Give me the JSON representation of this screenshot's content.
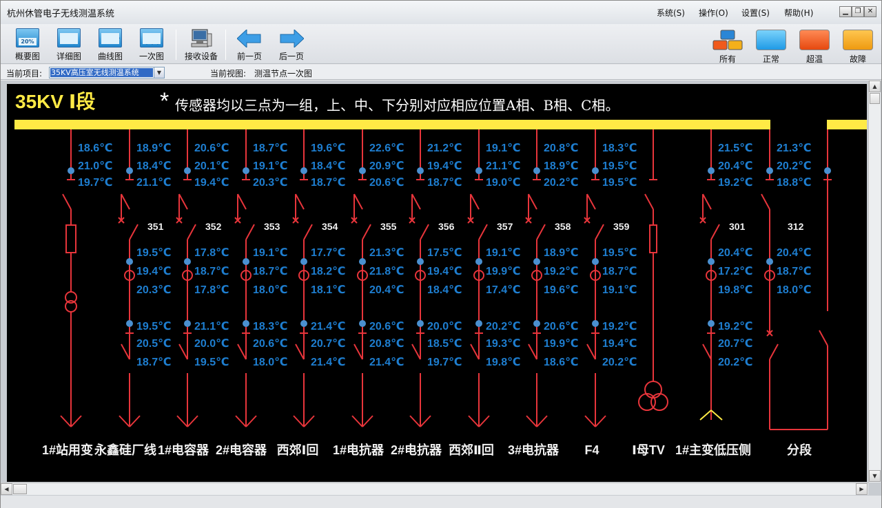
{
  "app": {
    "title": "杭州休管电子无线测温系统"
  },
  "menu": [
    {
      "label": "系统(S)"
    },
    {
      "label": "操作(O)"
    },
    {
      "label": "设置(S)"
    },
    {
      "label": "帮助(H)"
    }
  ],
  "window_buttons": [
    "minimize",
    "restore",
    "close"
  ],
  "toolbar": {
    "buttons": [
      {
        "label": "概要图",
        "icon": "overview-icon"
      },
      {
        "label": "详细图",
        "icon": "detail-icon"
      },
      {
        "label": "曲线图",
        "icon": "curve-icon"
      },
      {
        "label": "一次图",
        "icon": "primary-diagram-icon"
      },
      {
        "label": "接收设备",
        "icon": "receiver-device-icon"
      },
      {
        "label": "前一页",
        "icon": "prev-page-arrow-icon"
      },
      {
        "label": "后一页",
        "icon": "next-page-arrow-icon"
      }
    ],
    "overview_icon_text": "20%",
    "legend": [
      {
        "label": "所有",
        "color": "#2a86d6"
      },
      {
        "label": "正常",
        "color": "#2aa6f0"
      },
      {
        "label": "超温",
        "color": "#f05a1c"
      },
      {
        "label": "故障",
        "color": "#f4a21a"
      }
    ]
  },
  "infobar": {
    "project_label": "当前项目:",
    "project_value": "35KV高压室无线测温系统",
    "view_label": "当前视图:",
    "view_value": "测温节点一次图"
  },
  "diagram": {
    "section_title": "35KV Ⅰ段",
    "note_star": "*",
    "note": "传感器均以三点为一组，上、中、下分别对应相应位置A相、B相、C相。",
    "colors": {
      "bus": "#ffea45",
      "line": "#e8353b",
      "sensor": "#4a90d0",
      "temp": "#1e7ed0",
      "label": "#f0f0f0",
      "title": "#ffea45"
    },
    "feeders": [
      {
        "name": "1#站用变",
        "kind": "transformer",
        "no": "",
        "top": [
          "18.6℃",
          "21.0℃",
          "19.7℃"
        ],
        "mid": [],
        "low": []
      },
      {
        "name": "永鑫硅厂线",
        "kind": "feeder",
        "no": "351",
        "top": [
          "18.9℃",
          "18.4℃",
          "21.1℃"
        ],
        "mid": [
          "19.5℃",
          "19.4℃",
          "20.3℃"
        ],
        "low": [
          "19.5℃",
          "20.5℃",
          "18.7℃"
        ]
      },
      {
        "name": "1#电容器",
        "kind": "feeder",
        "no": "352",
        "top": [
          "20.6℃",
          "20.1℃",
          "19.4℃"
        ],
        "mid": [
          "17.8℃",
          "18.7℃",
          "17.8℃"
        ],
        "low": [
          "21.1℃",
          "20.0℃",
          "19.5℃"
        ]
      },
      {
        "name": "2#电容器",
        "kind": "feeder",
        "no": "353",
        "top": [
          "18.7℃",
          "19.1℃",
          "20.3℃"
        ],
        "mid": [
          "19.1℃",
          "18.7℃",
          "18.0℃"
        ],
        "low": [
          "18.3℃",
          "20.6℃",
          "18.0℃"
        ]
      },
      {
        "name": "西郊Ⅰ回",
        "kind": "feeder",
        "no": "354",
        "top": [
          "19.6℃",
          "18.4℃",
          "18.7℃"
        ],
        "mid": [
          "17.7℃",
          "18.2℃",
          "18.1℃"
        ],
        "low": [
          "21.4℃",
          "20.7℃",
          "21.4℃"
        ]
      },
      {
        "name": "1#电抗器",
        "kind": "feeder",
        "no": "355",
        "top": [
          "22.6℃",
          "20.9℃",
          "20.6℃"
        ],
        "mid": [
          "21.3℃",
          "21.8℃",
          "20.4℃"
        ],
        "low": [
          "20.6℃",
          "20.8℃",
          "21.4℃"
        ]
      },
      {
        "name": "2#电抗器",
        "kind": "feeder",
        "no": "356",
        "top": [
          "21.2℃",
          "19.4℃",
          "18.7℃"
        ],
        "mid": [
          "17.5℃",
          "19.4℃",
          "18.4℃"
        ],
        "low": [
          "20.0℃",
          "18.5℃",
          "19.7℃"
        ]
      },
      {
        "name": "西郊Ⅱ回",
        "kind": "feeder",
        "no": "357",
        "top": [
          "19.1℃",
          "21.1℃",
          "19.0℃"
        ],
        "mid": [
          "19.1℃",
          "19.9℃",
          "17.4℃"
        ],
        "low": [
          "20.2℃",
          "19.3℃",
          "19.8℃"
        ]
      },
      {
        "name": "3#电抗器",
        "kind": "feeder",
        "no": "358",
        "top": [
          "20.8℃",
          "18.9℃",
          "20.2℃"
        ],
        "mid": [
          "18.9℃",
          "19.2℃",
          "19.6℃"
        ],
        "low": [
          "20.6℃",
          "19.9℃",
          "18.6℃"
        ]
      },
      {
        "name": "F4",
        "kind": "feeder",
        "no": "359",
        "top": [
          "18.3℃",
          "19.5℃",
          "19.5℃"
        ],
        "mid": [
          "19.5℃",
          "18.7℃",
          "19.1℃"
        ],
        "low": [
          "19.2℃",
          "19.4℃",
          "20.2℃"
        ]
      },
      {
        "name": "Ⅰ母TV",
        "kind": "pt",
        "no": "",
        "top": [],
        "mid": [],
        "low": []
      },
      {
        "name": "1#主变低压侧",
        "kind": "incoming",
        "no": "301",
        "top": [
          "21.5℃",
          "20.4℃",
          "19.2℃"
        ],
        "mid": [
          "20.4℃",
          "17.2℃",
          "19.8℃"
        ],
        "low": [
          "19.2℃",
          "20.7℃",
          "20.2℃"
        ]
      },
      {
        "name": "分段",
        "kind": "tie",
        "no": "312",
        "top": [
          "21.3℃",
          "20.2℃",
          "18.8℃"
        ],
        "mid": [
          "20.4℃",
          "18.7℃",
          "18.0℃"
        ],
        "low": []
      }
    ]
  }
}
